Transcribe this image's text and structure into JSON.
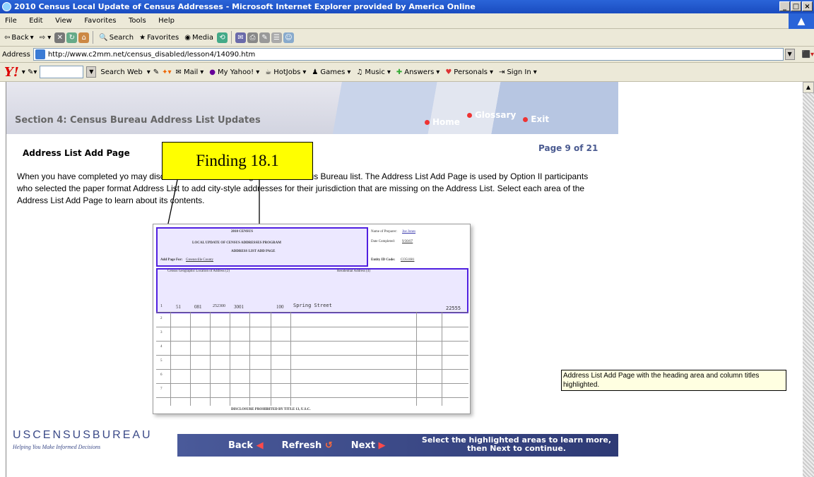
{
  "window": {
    "title": "2010 Census Local Update of Census Addresses - Microsoft Internet Explorer provided by America Online",
    "buttons": [
      "_",
      "̈",
      "X"
    ]
  },
  "menu": [
    "File",
    "Edit",
    "View",
    "Favorites",
    "Tools",
    "Help"
  ],
  "toolbar": {
    "back": "Back",
    "search": "Search",
    "favorites": "Favorites",
    "media": "Media"
  },
  "address": {
    "label": "Address",
    "url": "http://www.c2mm.net/census_disabled/lesson4/14090.htm"
  },
  "yahoo": {
    "logo": "Y!",
    "search_button": "Search Web",
    "items": [
      "Mail",
      "My Yahoo!",
      "HotJobs",
      "Games",
      "Music",
      "Answers",
      "Personals",
      "Sign In"
    ]
  },
  "lesson": {
    "section_title": "Section 4: Census Bureau Address List Updates",
    "nav_top": [
      "Home",
      "Glossary",
      "Exit"
    ],
    "page_number": "Page 9 of 21",
    "page_title": "Address List Add Page",
    "body_text": "When you have completed yo                                             may discover addresses missing from the Census Bureau list.  The Address List Add Page is used by Option II participants who selected the paper format Address List to add city-style addresses for their jurisdiction that are missing on the Address List. Select each area of the Address List Add Page to learn about its contents.",
    "finding_label": "Finding 18.1",
    "form": {
      "census_title": "2010 CENSUS",
      "program": "LOCAL UPDATE OF CENSUS ADDRESSES PROGRAM",
      "page_name": "ADDRESS LIST ADD PAGE",
      "add_page_for": "Add Page For:",
      "county": "Greensville County",
      "preparer_label": "Name of Preparer:",
      "preparer": "Joe Jones",
      "date_label": "Date Completed:",
      "date": "9/30/07",
      "entity_label": "Entity ID Code:",
      "entity": "CO51081",
      "col_group1": "Census Geographic Location of Address (2)",
      "col_group2": "Residential Address (4)",
      "row1": {
        "line": "1",
        "state": "51",
        "county": "081",
        "tract": "252300",
        "block": "3001",
        "house": "100",
        "street": "Spring Street",
        "zip": "22555"
      },
      "rows": [
        "2",
        "3",
        "4",
        "5",
        "6",
        "7"
      ],
      "footer": "DISCLOSURE PROHIBITED BY TITLE 13, U.S.C."
    },
    "bureau_name": "USCENSUSBUREAU",
    "bureau_tagline": "Helping You Make Informed Decisions",
    "nav_bottom": {
      "back": "Back",
      "refresh": "Refresh",
      "next": "Next",
      "instructions": "Select the highlighted areas to learn more, then Next to continue."
    }
  },
  "tooltip": "Address List Add Page with the heading area and column titles highlighted."
}
